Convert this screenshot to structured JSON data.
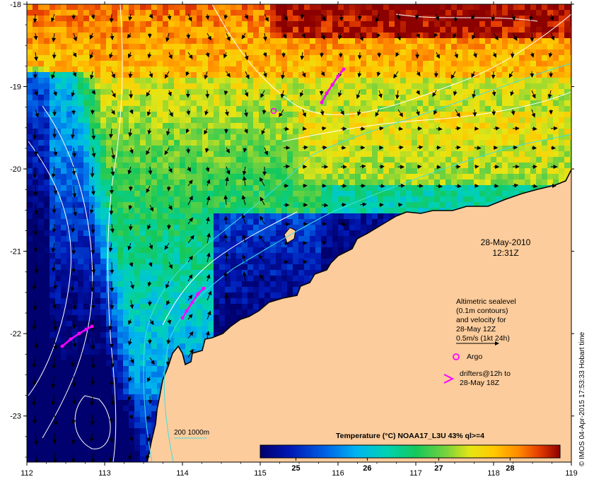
{
  "map": {
    "lon_ticks": [
      "112",
      "113",
      "114",
      "115",
      "116",
      "117",
      "118",
      "119"
    ],
    "lat_ticks": [
      "-18",
      "-19",
      "-20",
      "-21",
      "-22",
      "-23"
    ],
    "lon_range": [
      112,
      119
    ],
    "lat_range": [
      -23.56,
      -18
    ],
    "date_line1": "28-May-2010",
    "date_line2": "12:31Z",
    "legend": {
      "line1": "Altimetric sealevel",
      "line2": "(0.1m contours)",
      "line3": "and velocity for",
      "line4": "28-May 12Z",
      "line5": "0.5m/s (1kt 24h)",
      "argo_label": "Argo",
      "drifters_line1": "drifters@12h to",
      "drifters_line2": "28-May 18Z"
    },
    "scale_label": "200  1000m",
    "colorbar": {
      "title": "Temperature (°C) NOAA17_L3U 43% ql>=4",
      "ticks": [
        "25",
        "26",
        "27",
        "28"
      ],
      "range": [
        24.5,
        28.7
      ]
    },
    "side_caption": "© IMOS 04-Apr-2015 17:53:33 Hobart time",
    "colors": {
      "land": "#fccc9c",
      "drifter": "#ff00ff",
      "argo": "#ff00ff",
      "contour": "#ffffff",
      "isobath": "#40e0e0"
    }
  }
}
